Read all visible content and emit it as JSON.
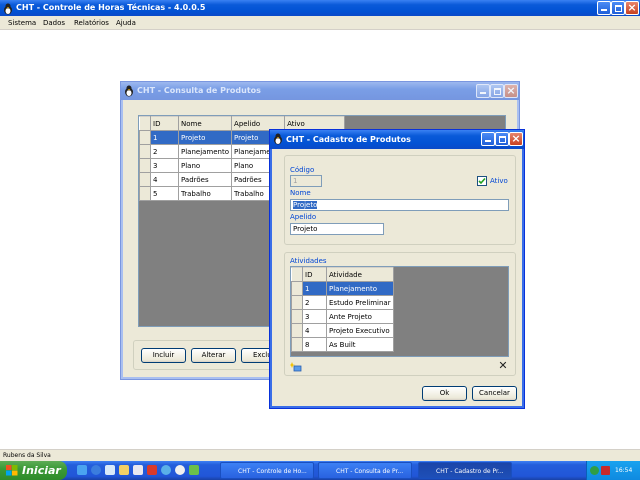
{
  "app": {
    "title": "CHT - Controle de Horas Técnicas - 4.0.0.5",
    "menu": [
      "Sistema",
      "Dados",
      "Relatórios",
      "Ajuda"
    ]
  },
  "consulta": {
    "title": "CHT - Consulta de Produtos",
    "columns": [
      "ID",
      "Nome",
      "Apelido",
      "Ativo"
    ],
    "rows": [
      [
        "1",
        "Projeto",
        "Projeto",
        ""
      ],
      [
        "2",
        "Planejamento",
        "Planejamento",
        ""
      ],
      [
        "3",
        "Plano",
        "Plano",
        ""
      ],
      [
        "4",
        "Padrões",
        "Padrões",
        ""
      ],
      [
        "5",
        "Trabalho",
        "Trabalho",
        ""
      ]
    ],
    "buttons": {
      "incluir": "Incluir",
      "alterar": "Alterar",
      "excluir": "Exclu"
    }
  },
  "cadastro": {
    "title": "CHT - Cadastro de Produtos",
    "codigo_label": "Código",
    "codigo_value": "1",
    "ativo_label": "Ativo",
    "ativo_checked": true,
    "nome_label": "Nome",
    "nome_value": "Projeto",
    "apelido_label": "Apelido",
    "apelido_value": "Projeto",
    "atividades_label": "Atividades",
    "columns": [
      "ID",
      "Atividade"
    ],
    "rows": [
      [
        "1",
        "Planejamento"
      ],
      [
        "2",
        "Estudo Preliminar"
      ],
      [
        "3",
        "Ante Projeto"
      ],
      [
        "4",
        "Projeto Executivo"
      ],
      [
        "8",
        "As Built"
      ]
    ],
    "delete_glyph": "✕",
    "buttons": {
      "ok": "Ok",
      "cancelar": "Cancelar"
    }
  },
  "status": {
    "user": "Rubens da Silva"
  },
  "taskbar": {
    "start": "Iniciar",
    "tasks": [
      "CHT - Controle de Ho...",
      "CHT - Consulta de Pr...",
      "CHT - Cadastro de Pr..."
    ],
    "clock": "16:54"
  },
  "colors": {
    "xp_blue": "#0a5ad9",
    "selection": "#316ac5",
    "start_green": "#3c9a37",
    "label_blue": "#0046d5"
  }
}
